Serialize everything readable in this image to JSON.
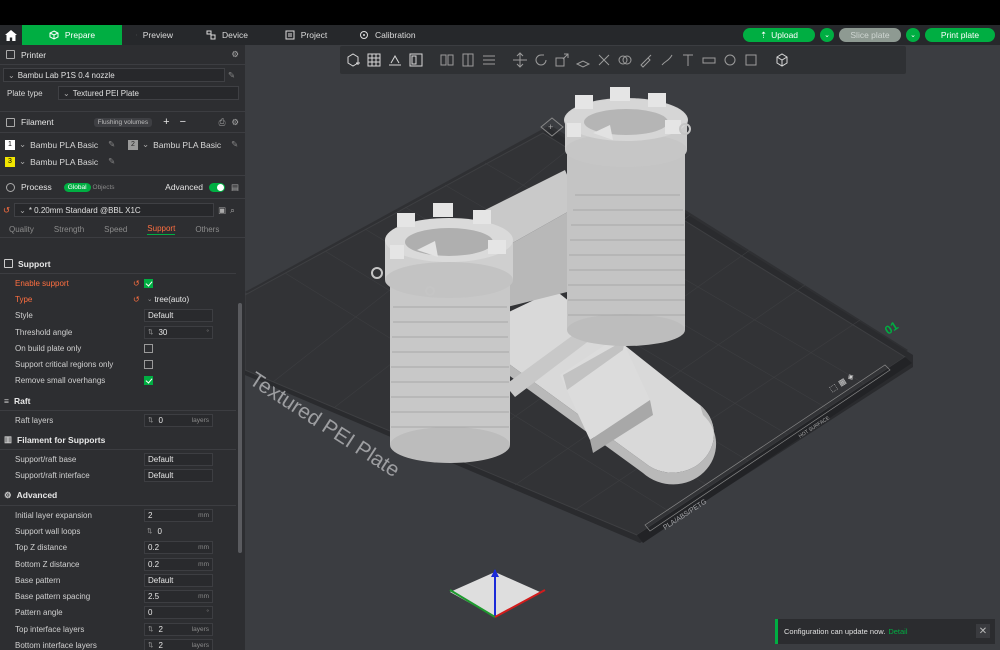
{
  "tabs": {
    "prepare": "Prepare",
    "preview": "Preview",
    "device": "Device",
    "project": "Project",
    "calibration": "Calibration"
  },
  "actions": {
    "upload": "Upload",
    "slice_plate": "Slice plate",
    "print_plate": "Print plate"
  },
  "printer": {
    "section_title": "Printer",
    "model": "Bambu Lab P1S 0.4 nozzle",
    "plate_type_label": "Plate type",
    "plate_type_value": "Textured PEI Plate"
  },
  "filament": {
    "section_title": "Filament",
    "flushing_label": "Flushing volumes",
    "slots": [
      {
        "num": "1",
        "name": "Bambu PLA Basic",
        "color": "#ffffff"
      },
      {
        "num": "2",
        "name": "Bambu PLA Basic",
        "color": "#9a9a9a"
      },
      {
        "num": "3",
        "name": "Bambu PLA Basic",
        "color": "#f2e600"
      }
    ]
  },
  "process": {
    "section_title": "Process",
    "global_label": "Global",
    "objects_label": "Objects",
    "advanced_label": "Advanced",
    "preset": "* 0.20mm Standard @BBL X1C"
  },
  "subtabs": [
    "Quality",
    "Strength",
    "Speed",
    "Support",
    "Others"
  ],
  "settings": {
    "support_title": "Support",
    "enable_support": "Enable support",
    "type_label": "Type",
    "type_value": "tree(auto)",
    "style_label": "Style",
    "style_value": "Default",
    "threshold_label": "Threshold angle",
    "threshold_value": "30",
    "build_plate_only": "On build plate only",
    "critical_regions": "Support critical regions only",
    "remove_overhangs": "Remove small overhangs",
    "raft_title": "Raft",
    "raft_layers_label": "Raft layers",
    "raft_layers_value": "0",
    "raft_layers_unit": "layers",
    "filament_supports_title": "Filament for Supports",
    "raft_base_label": "Support/raft base",
    "raft_base_value": "Default",
    "raft_interface_label": "Support/raft interface",
    "raft_interface_value": "Default",
    "advanced_title": "Advanced",
    "initial_expansion_label": "Initial layer expansion",
    "initial_expansion_value": "2",
    "mm": "mm",
    "wall_loops_label": "Support wall loops",
    "wall_loops_value": "0",
    "top_z_label": "Top Z distance",
    "top_z_value": "0.2",
    "bottom_z_label": "Bottom Z distance",
    "bottom_z_value": "0.2",
    "base_pattern_label": "Base pattern",
    "base_pattern_value": "Default",
    "base_spacing_label": "Base pattern spacing",
    "base_spacing_value": "2.5",
    "pattern_angle_label": "Pattern angle",
    "pattern_angle_value": "0",
    "top_interface_label": "Top interface layers",
    "top_interface_value": "2",
    "bottom_interface_label": "Bottom interface layers",
    "bottom_interface_value": "2",
    "layers": "layers"
  },
  "plate": {
    "label": "Textured PEI Plate",
    "number": "01",
    "materials": "PLA/ABS/PETG",
    "other_text": "HOT SURFACE"
  },
  "toast": {
    "message": "Configuration can update now.",
    "link": "Detail"
  },
  "colors": {
    "accent": "#00ae42",
    "warning": "#ff6f40"
  }
}
